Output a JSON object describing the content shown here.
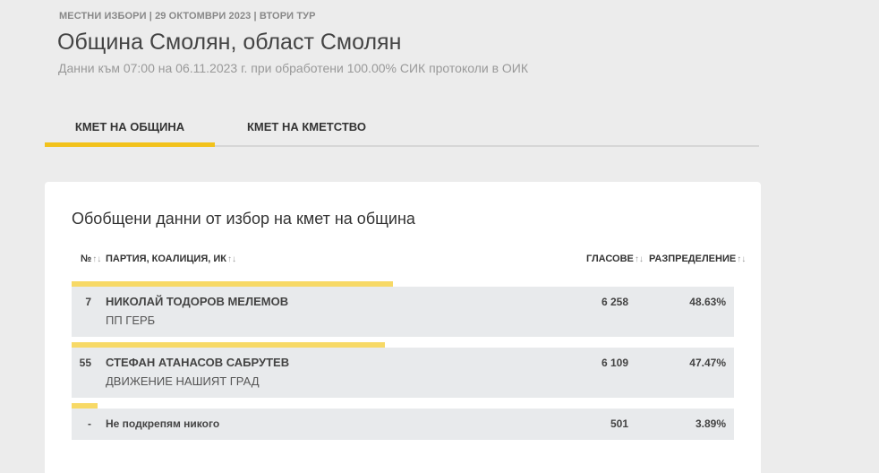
{
  "header": {
    "meta": "МЕСТНИ ИЗБОРИ | 29 ОКТОМВРИ 2023 | ВТОРИ ТУР",
    "title": "Община Смолян, област Смолян",
    "subtitle": "Данни към 07:00 на 06.11.2023 г. при обработени 100.00% СИК протоколи в ОИК"
  },
  "tabs": [
    {
      "label": "КМЕТ НА ОБЩИНА",
      "active": true
    },
    {
      "label": "КМЕТ НА КМЕТСТВО",
      "active": false
    }
  ],
  "accent_color": "#f2c21b",
  "bar_color": "#f7d966",
  "card": {
    "title": "Обобщени данни от избор на кмет на община",
    "columns": {
      "no": "№",
      "party": "ПАРТИЯ, КОАЛИЦИЯ, ИК",
      "votes": "ГЛАСОВЕ",
      "distribution": "РАЗПРЕДЕЛЕНИЕ",
      "sort_icon": "↑↓"
    },
    "rows": [
      {
        "no": "7",
        "name": "НИКОЛАЙ ТОДОРОВ МЕЛЕМОВ",
        "party": "ПП ГЕРБ",
        "votes": "6 258",
        "share": "48.63%",
        "share_value": 48.63
      },
      {
        "no": "55",
        "name": "СТЕФАН АТАНАСОВ САБРУТЕВ",
        "party": "ДВИЖЕНИЕ НАШИЯТ ГРАД",
        "votes": "6 109",
        "share": "47.47%",
        "share_value": 47.47
      },
      {
        "no": "-",
        "name": "Не подкрепям никого",
        "party": "",
        "votes": "501",
        "share": "3.89%",
        "share_value": 3.89
      }
    ]
  }
}
